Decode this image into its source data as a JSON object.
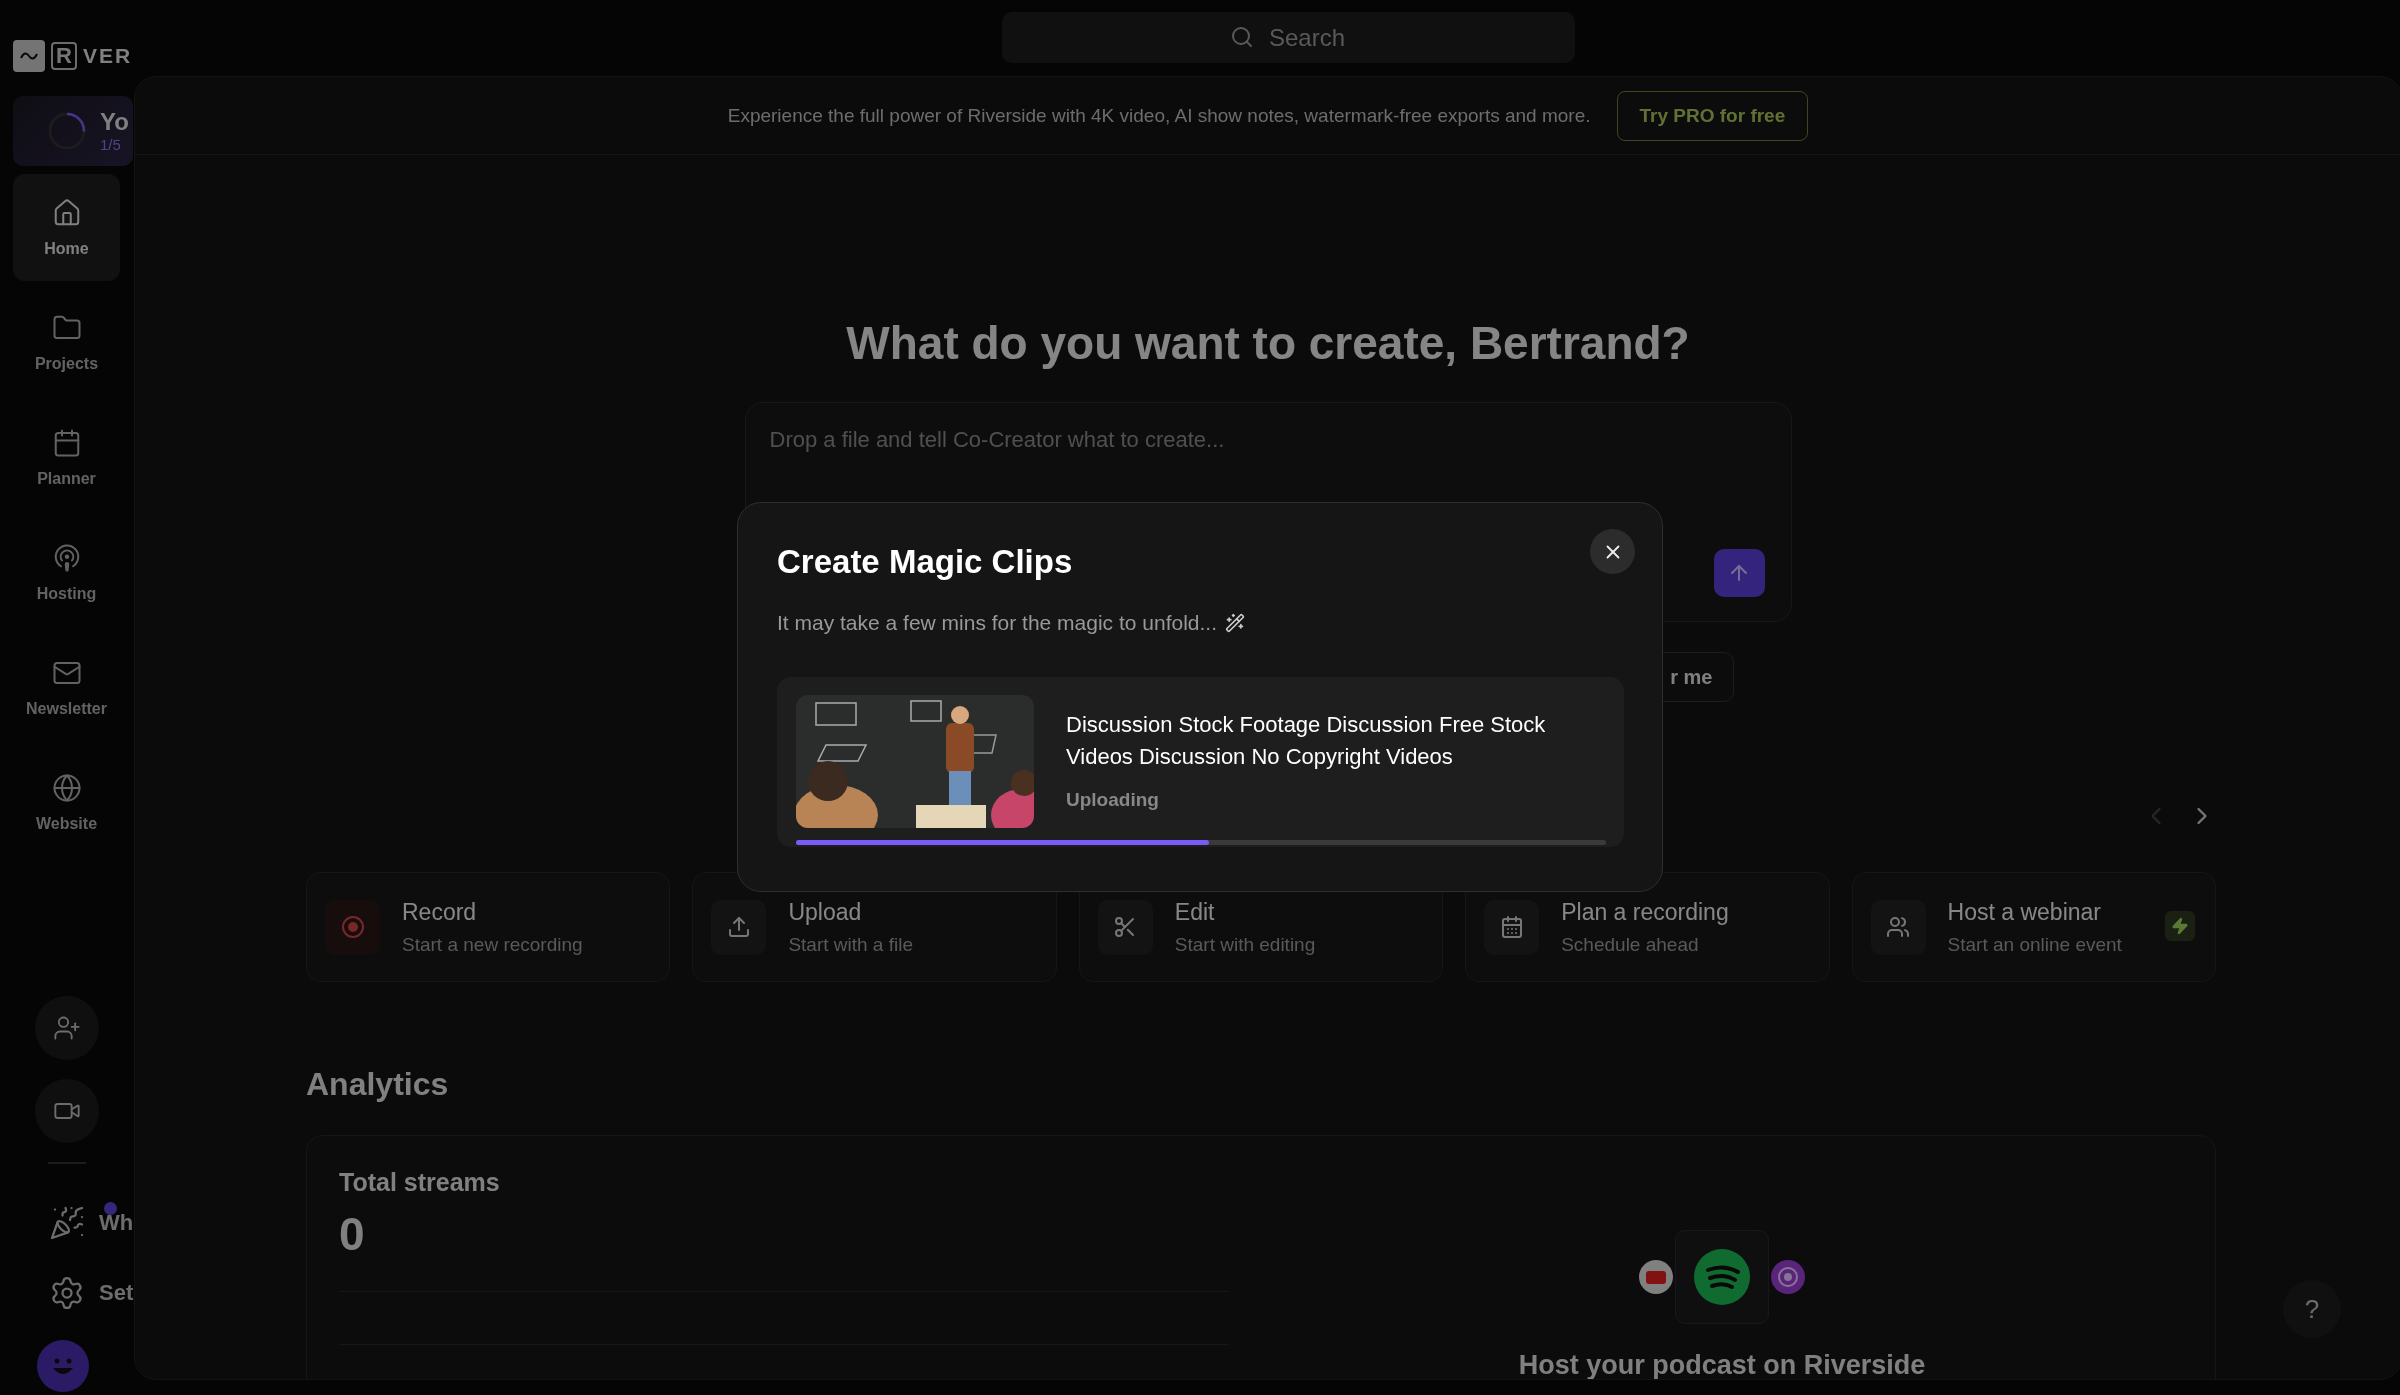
{
  "search": {
    "placeholder": "Search"
  },
  "sidebar": {
    "logo_mark": "R",
    "logo_text": "VER",
    "progress": {
      "title": "Yo",
      "subtitle": "1/5"
    },
    "nav": [
      {
        "label": "Home",
        "selected": true
      },
      {
        "label": "Projects",
        "selected": false
      },
      {
        "label": "Planner",
        "selected": false
      },
      {
        "label": "Hosting",
        "selected": false
      },
      {
        "label": "Newsletter",
        "selected": false
      },
      {
        "label": "Website",
        "selected": false
      }
    ],
    "bottom": [
      {
        "label": "Wh",
        "dot": true
      },
      {
        "label": "Set",
        "dot": false
      }
    ]
  },
  "banner": {
    "text": "Experience the full power of Riverside with 4K video, AI show notes, watermark-free exports and more.",
    "button": "Try PRO for free"
  },
  "heading": "What do you want to create, Bertrand?",
  "prompt": {
    "placeholder": "Drop a file and tell Co-Creator what to create..."
  },
  "chip": "r me",
  "carousel": {
    "prev_disabled": true,
    "next_disabled": false
  },
  "actions": [
    {
      "title": "Record",
      "subtitle": "Start a new recording",
      "pro": false
    },
    {
      "title": "Upload",
      "subtitle": "Start with a file",
      "pro": false
    },
    {
      "title": "Edit",
      "subtitle": "Start with editing",
      "pro": false
    },
    {
      "title": "Plan a recording",
      "subtitle": "Schedule ahead",
      "pro": false
    },
    {
      "title": "Host a webinar",
      "subtitle": "Start an online event",
      "pro": true
    }
  ],
  "analytics": {
    "title": "Analytics",
    "label": "Total streams",
    "value": "0",
    "promo": "Host your podcast on Riverside"
  },
  "help": "?",
  "modal": {
    "title": "Create Magic Clips",
    "subtitle": "It may take a few mins for the magic to unfold...",
    "item": {
      "kind": "picture",
      "title": "Discussion Stock Footage Discussion Free Stock Videos Discussion No Copyright Videos",
      "status": "Uploading",
      "level": 0.51
    }
  }
}
